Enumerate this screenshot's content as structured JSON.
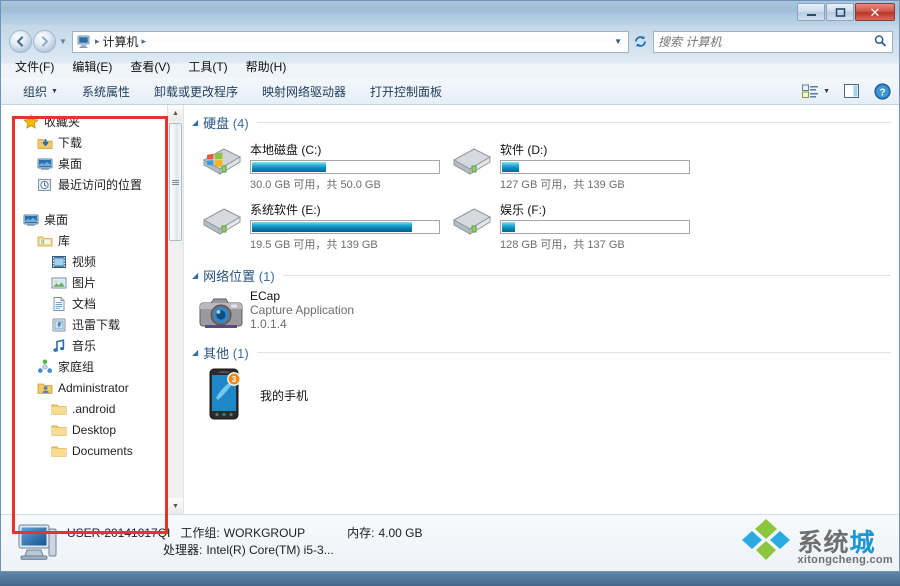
{
  "window": {
    "title": "",
    "buttons": {
      "minimize": "minimize-icon",
      "maximize": "maximize-icon",
      "close": "✕"
    }
  },
  "nav": {
    "back_icon": "back-arrow-icon",
    "forward_icon": "forward-arrow-icon",
    "history_caret": "▼",
    "breadcrumb": {
      "root_icon": "computer-icon",
      "items": [
        "计算机"
      ],
      "sep": "▸",
      "trailing_sep": "▸"
    },
    "address_caret": "▼",
    "refresh_icon": "↻",
    "search": {
      "placeholder": "搜索 计算机",
      "value": "",
      "icon": "search-icon"
    }
  },
  "menubar": {
    "items": [
      "文件(F)",
      "编辑(E)",
      "查看(V)",
      "工具(T)",
      "帮助(H)"
    ]
  },
  "toolbar": {
    "organize": "组织",
    "organize_caret": "▼",
    "items": [
      "系统属性",
      "卸载或更改程序",
      "映射网络驱动器",
      "打开控制面板"
    ],
    "view_caret": "▼",
    "view_icon": "view-layout-icon",
    "preview_icon": "preview-pane-icon",
    "help_icon": "help-icon"
  },
  "sidebar": {
    "groups": [
      {
        "items": [
          {
            "label": "收藏夹",
            "icon": "star-icon",
            "level": 0
          },
          {
            "label": "下载",
            "icon": "downloads-icon",
            "level": 1
          },
          {
            "label": "桌面",
            "icon": "desktop-icon",
            "level": 1
          },
          {
            "label": "最近访问的位置",
            "icon": "recent-places-icon",
            "level": 1
          }
        ]
      },
      {
        "items": [
          {
            "label": "桌面",
            "icon": "desktop-icon",
            "level": 0
          },
          {
            "label": "库",
            "icon": "library-icon",
            "level": 1
          },
          {
            "label": "视频",
            "icon": "video-icon",
            "level": 2
          },
          {
            "label": "图片",
            "icon": "pictures-icon",
            "level": 2
          },
          {
            "label": "文档",
            "icon": "documents-icon",
            "level": 2
          },
          {
            "label": "迅雷下载",
            "icon": "thunder-download-icon",
            "level": 2
          },
          {
            "label": "音乐",
            "icon": "music-icon",
            "level": 2
          },
          {
            "label": "家庭组",
            "icon": "homegroup-icon",
            "level": 1
          },
          {
            "label": "Administrator",
            "icon": "user-folder-icon",
            "level": 1
          },
          {
            "label": ".android",
            "icon": "folder-icon",
            "level": 2
          },
          {
            "label": "Desktop",
            "icon": "folder-icon",
            "level": 2
          },
          {
            "label": "Documents",
            "icon": "folder-icon",
            "level": 2
          }
        ]
      }
    ],
    "scroll": {
      "up": "▲",
      "down": "▼"
    }
  },
  "content": {
    "sections": [
      {
        "caret": "◢",
        "title": "硬盘",
        "count": "(4)",
        "type": "drives",
        "drives": [
          {
            "name": "本地磁盘 (C:)",
            "free": "30.0 GB",
            "total": "50.0 GB",
            "sub": "30.0 GB 可用，共 50.0 GB",
            "used_pct": 40,
            "icon": "system-drive-icon"
          },
          {
            "name": "软件 (D:)",
            "free": "127 GB",
            "total": "139 GB",
            "sub": "127 GB 可用，共 139 GB",
            "used_pct": 9,
            "icon": "drive-icon"
          },
          {
            "name": "系统软件 (E:)",
            "free": "19.5 GB",
            "total": "139 GB",
            "sub": "19.5 GB 可用，共 139 GB",
            "used_pct": 86,
            "icon": "drive-icon"
          },
          {
            "name": "娱乐 (F:)",
            "free": "128 GB",
            "total": "137 GB",
            "sub": "128 GB 可用，共 137 GB",
            "used_pct": 7,
            "icon": "drive-icon"
          }
        ]
      },
      {
        "caret": "◢",
        "title": "网络位置",
        "count": "(1)",
        "type": "network",
        "item": {
          "name": "ECap",
          "desc": "Capture Application",
          "version": "1.0.1.4",
          "icon": "camera-icon"
        }
      },
      {
        "caret": "◢",
        "title": "其他",
        "count": "(1)",
        "type": "other",
        "item": {
          "name": "我的手机",
          "icon": "phone-icon",
          "badge": "3"
        }
      }
    ]
  },
  "status": {
    "icon": "computer-icon",
    "computer_name": "USER-20141017QI",
    "workgroup_label": "工作组:",
    "workgroup_value": "WORKGROUP",
    "memory_label": "内存:",
    "memory_value": "4.00 GB",
    "cpu_label": "处理器:",
    "cpu_value": "Intel(R) Core(TM) i5-3..."
  },
  "watermark": {
    "cn_gray": "系统",
    "cn_blue": "城",
    "url": "xitongcheng.com"
  },
  "colors": {
    "accent_blue": "#1b95d4",
    "drive_bar": "#0e84b4",
    "section_title": "#26537f",
    "annotation_red": "#e8332a",
    "close_button": "#b83628"
  }
}
